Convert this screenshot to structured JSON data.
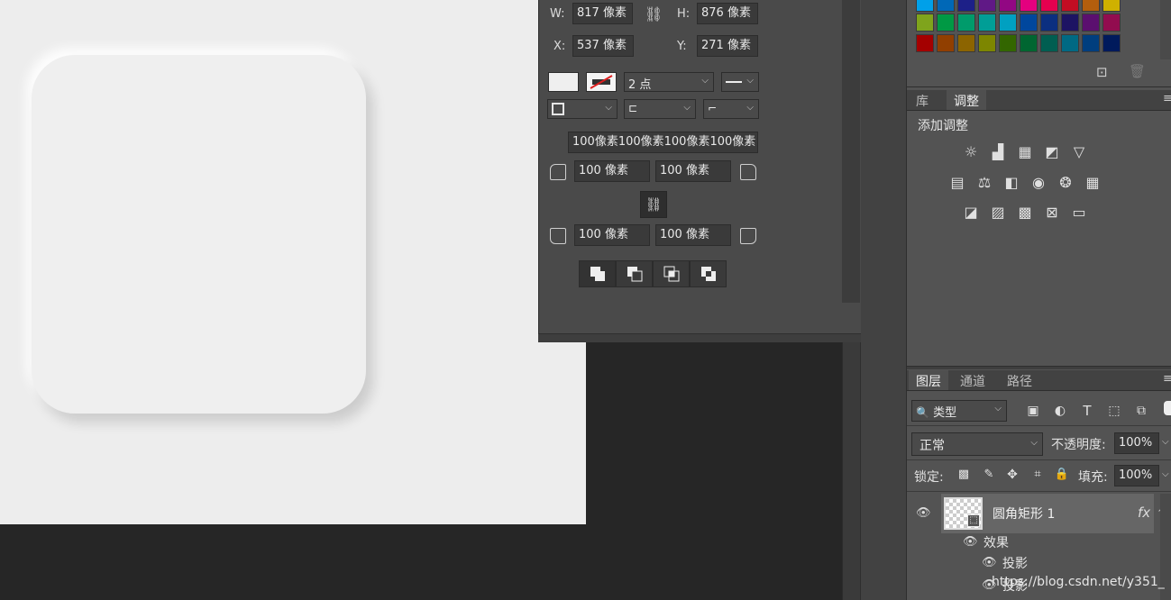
{
  "properties": {
    "w_label": "W:",
    "w_value": "817 像素",
    "h_label": "H:",
    "h_value": "876 像素",
    "x_label": "X:",
    "x_value": "537 像素",
    "y_label": "Y:",
    "y_value": "271 像素",
    "stroke_width": "2 点",
    "corner_radii_all": "100像素100像素100像素100像素",
    "tl_radius": "100 像素",
    "tr_radius": "100 像素",
    "bl_radius": "100 像素",
    "br_radius": "100 像素"
  },
  "swatches": {
    "rows": [
      [
        "#00a0e9",
        "#0068b7",
        "#1d2088",
        "#601986",
        "#920783",
        "#e4007f",
        "#e5004f",
        "#c30d23",
        "#b35e0d",
        "#cfb100"
      ],
      [
        "#7fa41c",
        "#009944",
        "#009b6b",
        "#009e96",
        "#00a0c1",
        "#00479d",
        "#0b2f80",
        "#1d1463",
        "#5b0f6f",
        "#920c4f"
      ],
      [
        "#a40000",
        "#913f00",
        "#8c6400",
        "#7d8600",
        "#336600",
        "#006631",
        "#005e51",
        "#006983",
        "#003e7e",
        "#001a5c"
      ]
    ]
  },
  "adjustments": {
    "tab_library": "库",
    "tab_adjust": "调整",
    "title": "添加调整"
  },
  "layers": {
    "tab_layers": "图层",
    "tab_channels": "通道",
    "tab_paths": "路径",
    "filter_kind": "类型",
    "blend_mode": "正常",
    "opacity_label": "不透明度:",
    "opacity_value": "100%",
    "lock_label": "锁定:",
    "fill_label": "填充:",
    "fill_value": "100%",
    "layer_name": "圆角矩形  1",
    "fx": "fx",
    "effects_label": "效果",
    "effect_1": "投影",
    "effect_2": "投影"
  },
  "watermark": "https://blog.csdn.net/y351_"
}
